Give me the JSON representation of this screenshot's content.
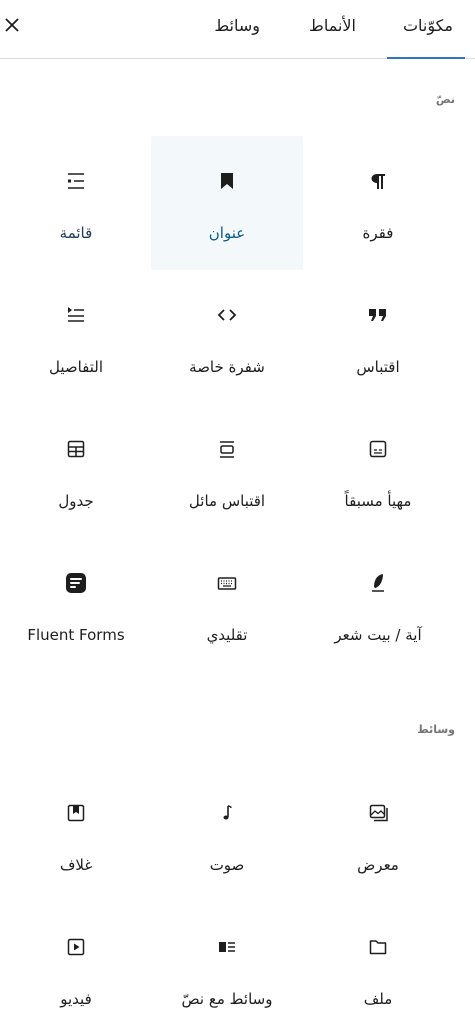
{
  "tabs": [
    {
      "label": "مكوّنات",
      "active": true
    },
    {
      "label": "الأنماط",
      "active": false
    },
    {
      "label": "وسائط",
      "active": false
    }
  ],
  "close_icon": "close-icon",
  "sections": [
    {
      "title": "نصّ"
    },
    {
      "title": "وسائط"
    }
  ],
  "blocks": [
    {
      "label": "فقرة",
      "icon": "paragraph-icon"
    },
    {
      "label": "عنوان",
      "icon": "heading-icon",
      "selected": true
    },
    {
      "label": "قائمة",
      "icon": "list-icon"
    },
    {
      "label": "اقتباس",
      "icon": "quote-icon"
    },
    {
      "label": "شفرة خاصة",
      "icon": "code-icon"
    },
    {
      "label": "التفاصيل",
      "icon": "details-icon"
    },
    {
      "label": "مهيأ مسبقاً",
      "icon": "preformatted-icon"
    },
    {
      "label": "اقتباس مائل",
      "icon": "pullquote-icon"
    },
    {
      "label": "جدول",
      "icon": "table-icon"
    },
    {
      "label": "آية / بيت شعر",
      "icon": "verse-icon"
    },
    {
      "label": "تقليدي",
      "icon": "keyboard-icon"
    },
    {
      "label": "Fluent Forms",
      "icon": "fluent-forms-icon"
    },
    {
      "label": "معرض",
      "icon": "gallery-icon"
    },
    {
      "label": "صوت",
      "icon": "audio-icon"
    },
    {
      "label": "غلاف",
      "icon": "cover-icon"
    },
    {
      "label": "ملف",
      "icon": "file-icon"
    },
    {
      "label": "وسائط مع نصّ",
      "icon": "media-text-icon"
    },
    {
      "label": "فيديو",
      "icon": "video-icon"
    }
  ]
}
